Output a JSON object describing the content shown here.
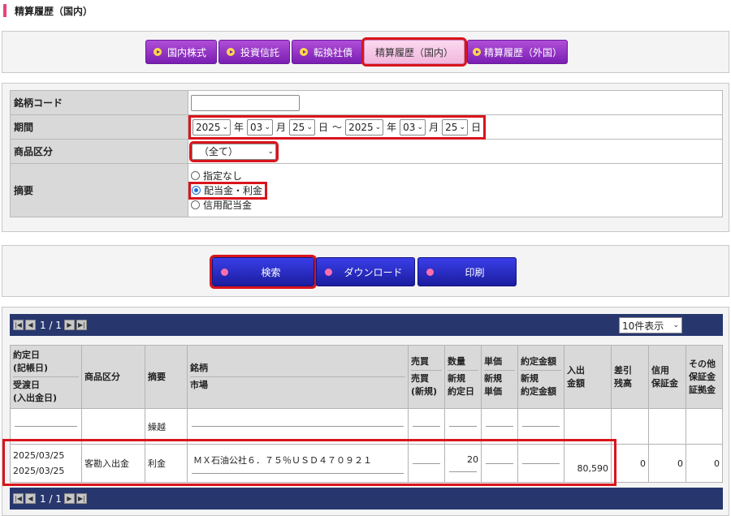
{
  "page_title": "精算履歴（国内）",
  "tabs": [
    {
      "label": "国内株式",
      "active": false
    },
    {
      "label": "投資信託",
      "active": false
    },
    {
      "label": "転換社債",
      "active": false
    },
    {
      "label": "精算履歴（国内）",
      "active": true
    },
    {
      "label": "精算履歴（外国）",
      "active": false
    }
  ],
  "form": {
    "code_label": "銘柄コード",
    "code_value": "",
    "period_label": "期間",
    "period": {
      "from_year": "2025",
      "from_month": "03",
      "from_day": "25",
      "to_year": "2025",
      "to_month": "03",
      "to_day": "25",
      "year_unit": "年",
      "month_unit": "月",
      "day_unit": "日",
      "separator": "～"
    },
    "product_label": "商品区分",
    "product_value": "（全て）",
    "summary_label": "摘要",
    "summary_options": [
      {
        "label": "指定なし",
        "checked": false
      },
      {
        "label": "配当金・利金",
        "checked": true
      },
      {
        "label": "信用配当金",
        "checked": false
      }
    ]
  },
  "actions": {
    "search": "検索",
    "download": "ダウンロード",
    "print": "印刷"
  },
  "pager": {
    "text": "1 / 1",
    "per_page": "10件表示"
  },
  "table": {
    "headers": {
      "date": [
        "約定日",
        "(記帳日)",
        "受渡日",
        "(入出金日)"
      ],
      "product": "商品区分",
      "summary": "摘要",
      "issue": [
        "銘柄",
        "市場"
      ],
      "trade": [
        "売買",
        "売買",
        "(新規)"
      ],
      "qty": [
        "数量",
        "新規",
        "約定日"
      ],
      "price": [
        "単価",
        "新規",
        "単価"
      ],
      "amount": [
        "約定金額",
        "新規",
        "約定金額"
      ],
      "cash": [
        "入出",
        "金額"
      ],
      "balance": [
        "差引",
        "残高"
      ],
      "margin": [
        "信用",
        "保証金"
      ],
      "other": [
        "その他",
        "保証金",
        "証拠金"
      ]
    },
    "carry_row": {
      "summary": "繰越"
    },
    "rows": [
      {
        "trade_date": "2025/03/25",
        "settle_date": "2025/03/25",
        "product": "客勘入出金",
        "summary": "利金",
        "issue": "ＭＸ石油公社６．７５％ＵＳＤ４７０９２１",
        "qty": "20",
        "cash": "80,590",
        "balance": "0",
        "margin": "0",
        "other": "0"
      }
    ]
  }
}
